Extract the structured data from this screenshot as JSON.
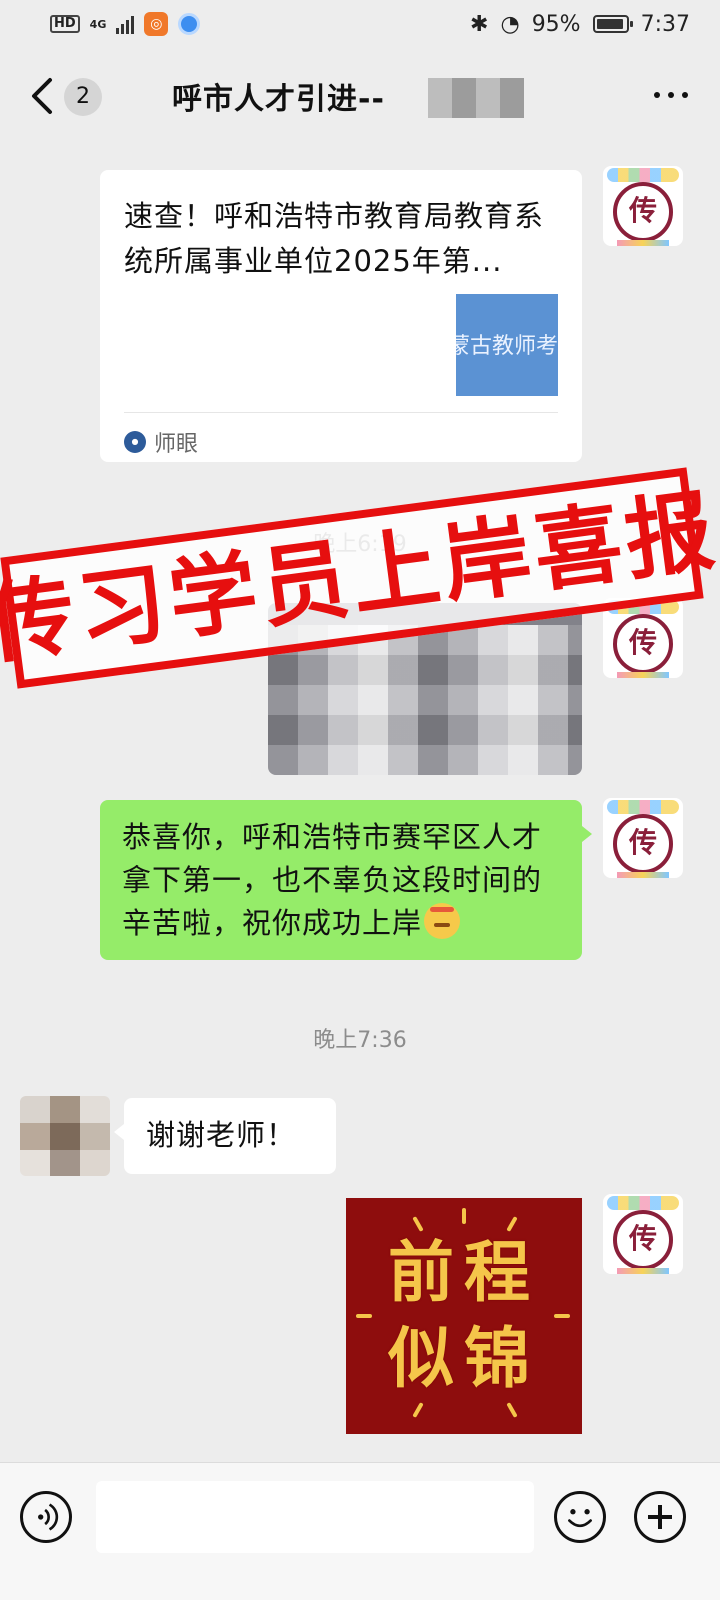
{
  "status_bar": {
    "hd": "HD",
    "network": "4G",
    "battery_level": "95%",
    "battery_fraction": 0.95,
    "time": "7:37"
  },
  "header": {
    "title": "呼市人才引进--",
    "unread_count": "2"
  },
  "messages": {
    "article": {
      "title": "速查！呼和浩特市教育局教育系统所属事业单位2025年第...",
      "thumb_text": "蒙古教师考",
      "source": "师眼"
    },
    "time1": "晚上6:19",
    "congrats_text": "恭喜你，呼和浩特市赛罕区人才拿下第一，也不辜负这段时间的辛苦啦，祝你成功上岸",
    "time2": "晚上7:36",
    "reply_text": "谢谢老师！",
    "sticker": {
      "line1": "前程",
      "line2": "似锦"
    }
  },
  "overlay": {
    "stamp_text": "传习学员上岸喜报"
  },
  "avatar": {
    "self_logo_char": "传"
  },
  "icons": {
    "back": "chevron-left-icon",
    "more": "more-dots-icon",
    "voice": "voice-icon",
    "emoji": "emoji-icon",
    "plus": "plus-icon"
  },
  "colors": {
    "chat_bg": "#ededed",
    "self_bubble": "#95ec69",
    "stamp_red": "#e60f0f",
    "sticker_bg": "#8e0d0d"
  }
}
